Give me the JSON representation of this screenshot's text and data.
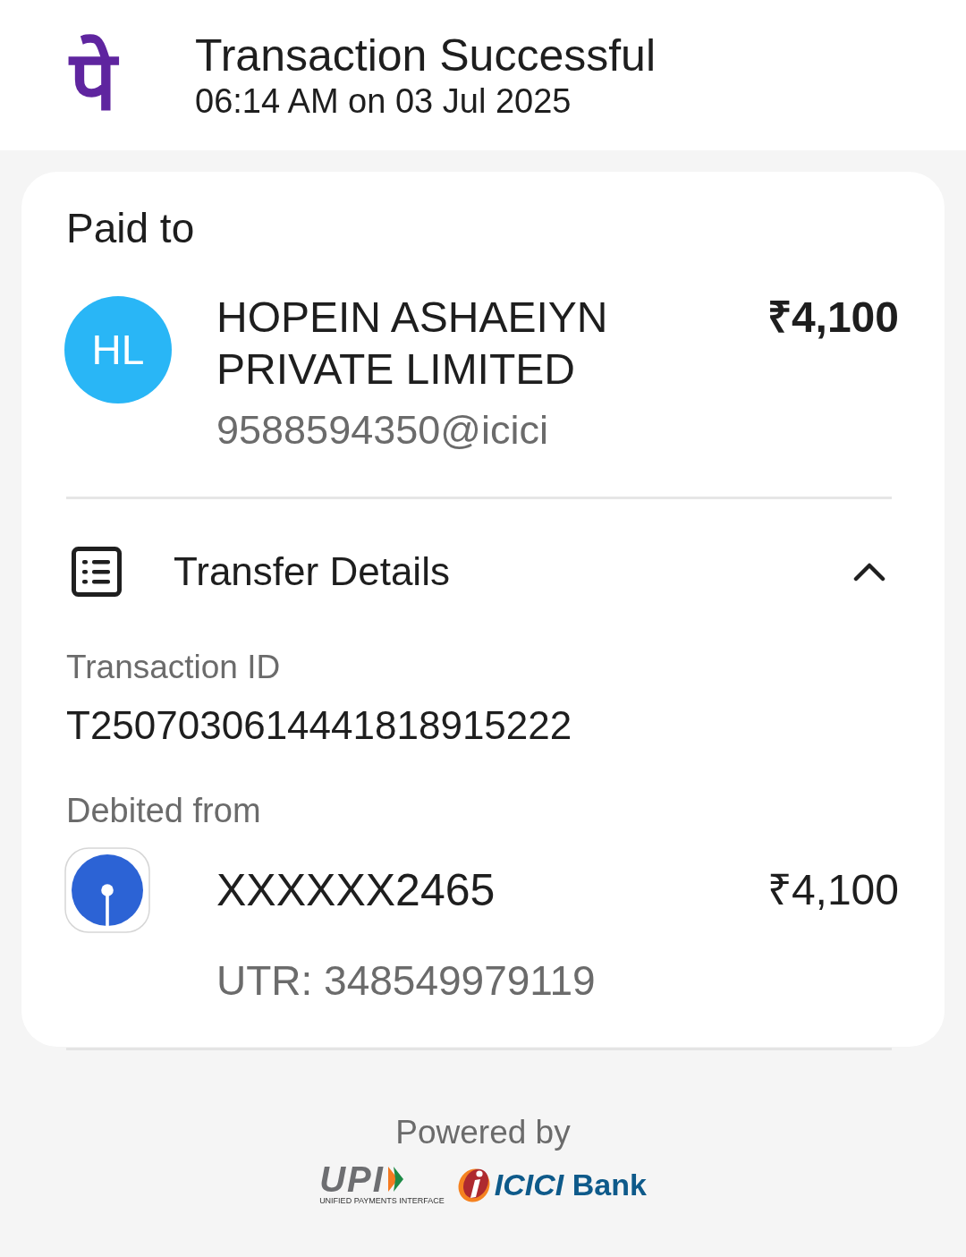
{
  "header": {
    "logo": "पे",
    "title": "Transaction Successful",
    "subtitle": "06:14 AM on 03 Jul 2025"
  },
  "payee": {
    "label": "Paid to",
    "initials": "HL",
    "name": "HOPEIN ASHAEIYN PRIVATE LIMITED",
    "upi_id": "9588594350@icici",
    "amount": "₹4,100"
  },
  "transfer_details": {
    "title": "Transfer Details",
    "expanded": true,
    "transaction_id": {
      "label": "Transaction ID",
      "value": "T2507030614441818915222"
    },
    "debited_from": {
      "label": "Debited from",
      "account": "XXXXXX2465",
      "amount": "₹4,100",
      "utr": "UTR: 348549979119"
    }
  },
  "footer": {
    "powered_by": "Powered by",
    "upi": {
      "wordmark": "UPI",
      "tagline": "UNIFIED PAYMENTS INTERFACE"
    },
    "bank": "*ICICI* Bank"
  }
}
